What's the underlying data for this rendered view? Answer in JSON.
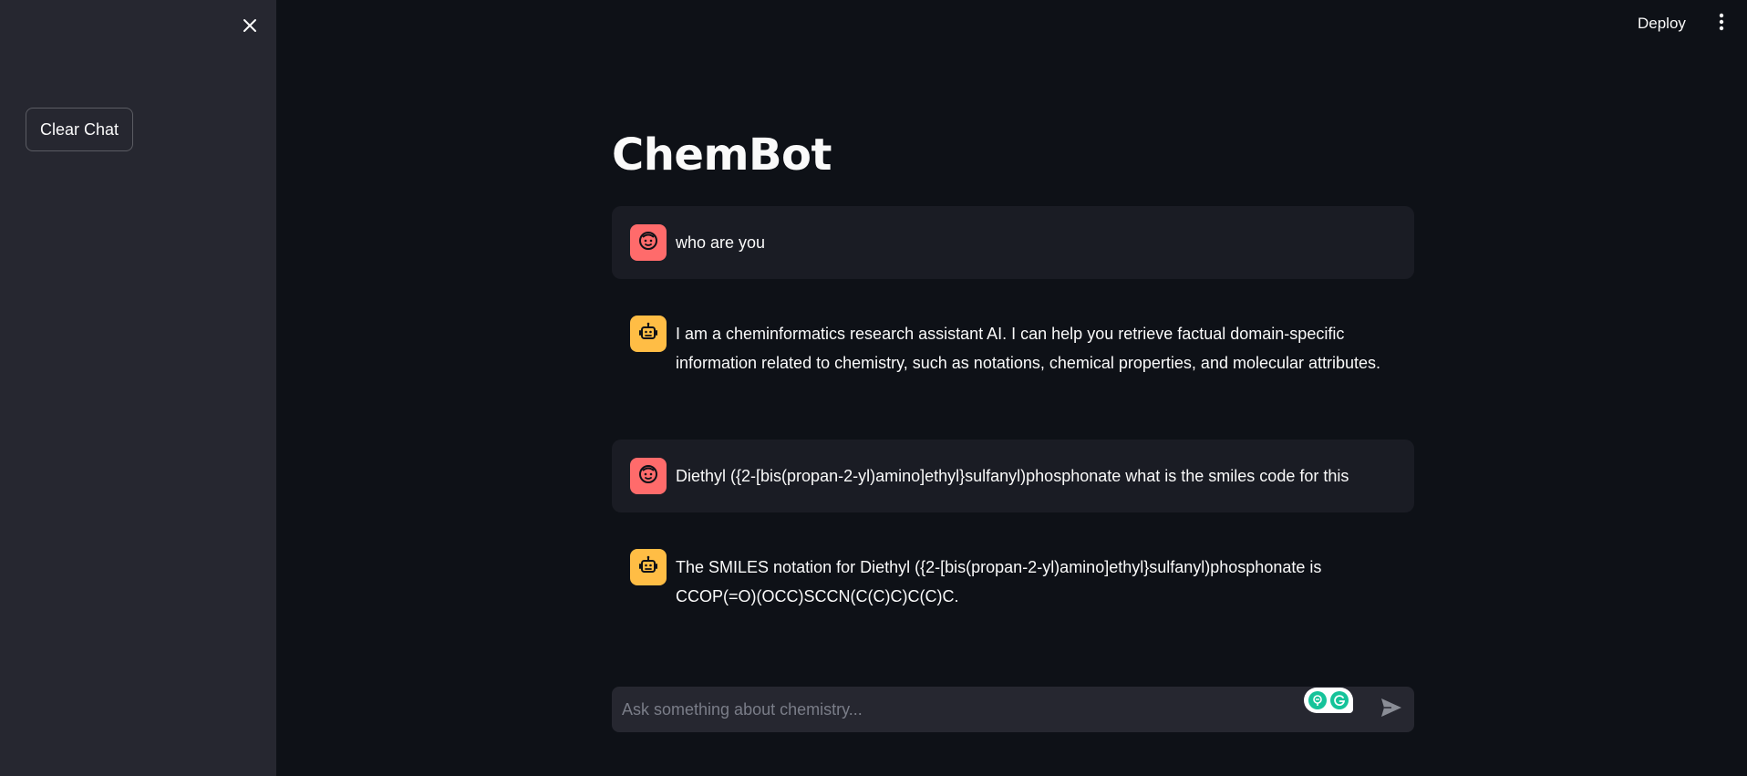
{
  "sidebar": {
    "close_icon": "close-icon",
    "clear_chat_label": "Clear Chat"
  },
  "header": {
    "deploy_label": "Deploy",
    "menu_icon": "vertical-dots-icon"
  },
  "main": {
    "title": "ChemBot",
    "messages": [
      {
        "role": "user",
        "avatar_icon": "user-face-icon",
        "text": "who are you"
      },
      {
        "role": "assistant",
        "avatar_icon": "robot-icon",
        "text": "I am a cheminformatics research assistant AI. I can help you retrieve factual domain-specific information related to chemistry, such as notations, chemical properties, and molecular attributes."
      },
      {
        "role": "user",
        "avatar_icon": "user-face-icon",
        "text": "Diethyl ({2-[bis(propan-2-yl)amino]ethyl}sulfanyl)phosphonate what is the smiles code for this"
      },
      {
        "role": "assistant",
        "avatar_icon": "robot-icon",
        "text": "The SMILES notation for Diethyl ({2-[bis(propan-2-yl)amino]ethyl}sulfanyl)phosphonate is CCOP(=O)(OCC)SCCN(C(C)C)C(C)C."
      }
    ]
  },
  "chat_input": {
    "placeholder": "Ask something about chemistry...",
    "value": "",
    "send_icon": "send-icon"
  },
  "grammarly": {
    "icons": [
      "grammarly-assist-icon",
      "grammarly-g-icon"
    ]
  },
  "colors": {
    "background": "#0e1117",
    "sidebar": "#262730",
    "user_avatar": "#ff6b6b",
    "assistant_avatar": "#ffbd45",
    "user_message_bg": "#1a1c24",
    "grammarly_green": "#15c39a"
  }
}
